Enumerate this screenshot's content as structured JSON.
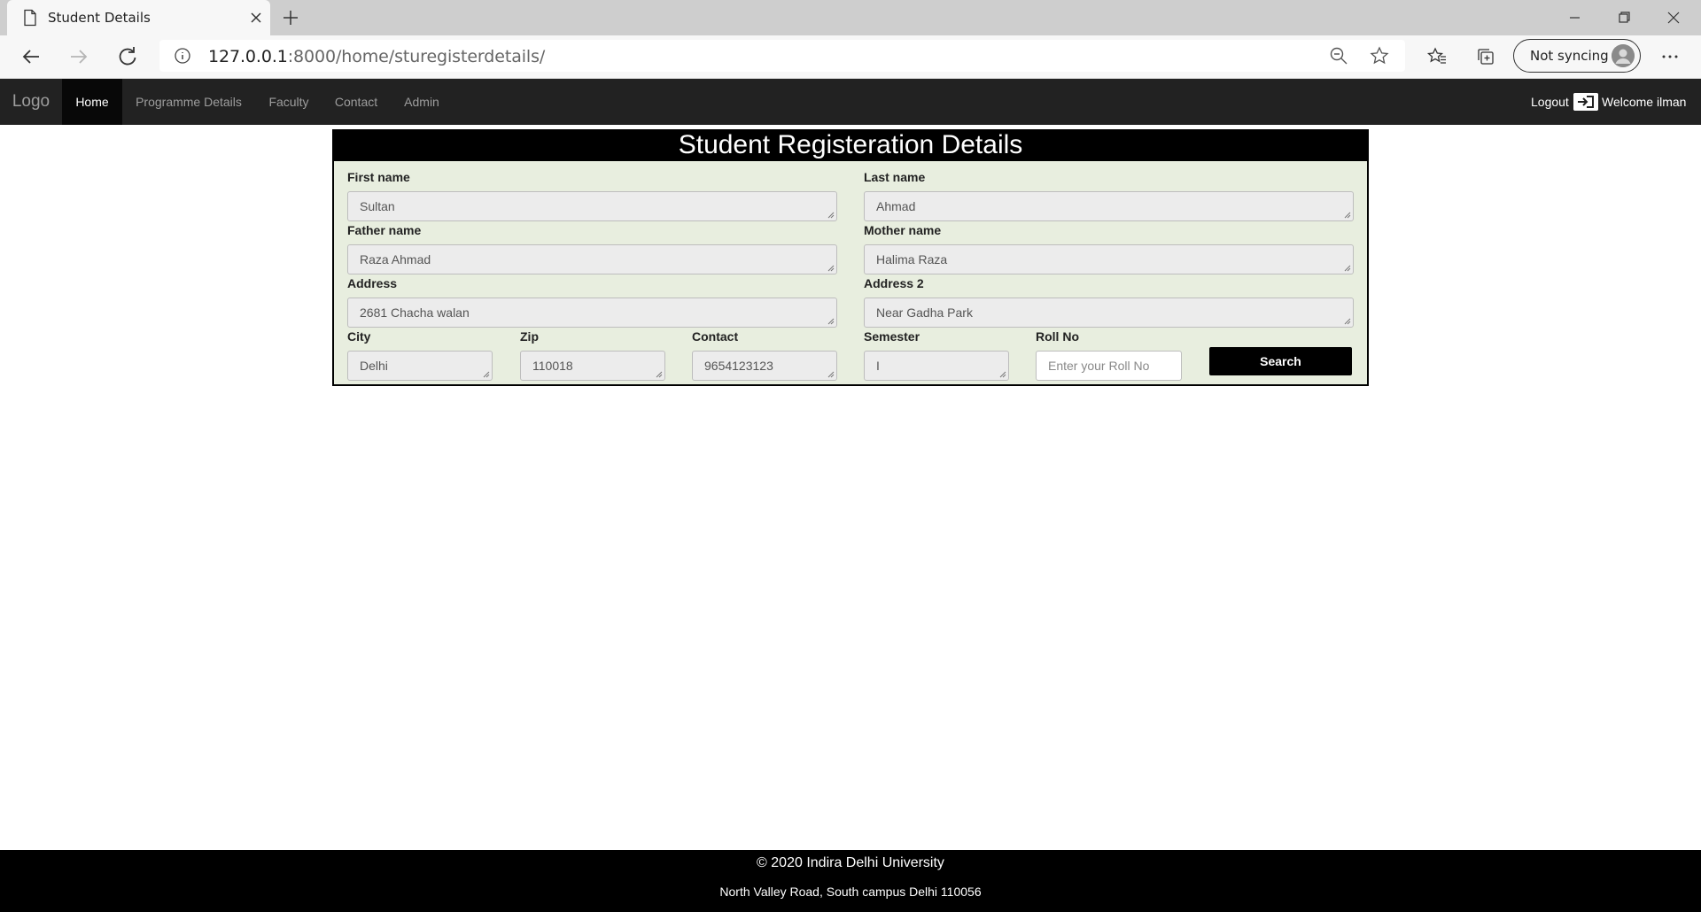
{
  "browser": {
    "tab_title": "Student Details",
    "url_host": "127.0.0.1",
    "url_rest": ":8000/home/sturegisterdetails/",
    "sync_label": "Not syncing"
  },
  "nav": {
    "brand": "Logo",
    "items": [
      "Home",
      "Programme Details",
      "Faculty",
      "Contact",
      "Admin"
    ],
    "logout": "Logout",
    "welcome": "Welcome ilman"
  },
  "form": {
    "title": "Student Registeration Details",
    "first_name_label": "First name",
    "first_name": "Sultan",
    "last_name_label": "Last name",
    "last_name": "Ahmad",
    "father_label": "Father name",
    "father": "Raza Ahmad",
    "mother_label": "Mother name",
    "mother": "Halima Raza",
    "address_label": "Address",
    "address": "2681 Chacha walan",
    "address2_label": "Address 2",
    "address2": "Near Gadha Park",
    "city_label": "City",
    "city": "Delhi",
    "zip_label": "Zip",
    "zip": "110018",
    "contact_label": "Contact",
    "contact": "9654123123",
    "semester_label": "Semester",
    "semester": "I",
    "rollno_label": "Roll No",
    "rollno_placeholder": "Enter your Roll No",
    "search_label": "Search"
  },
  "footer": {
    "copyright": "© 2020 Indira Delhi University",
    "address": "North Valley Road, South campus Delhi 110056"
  }
}
